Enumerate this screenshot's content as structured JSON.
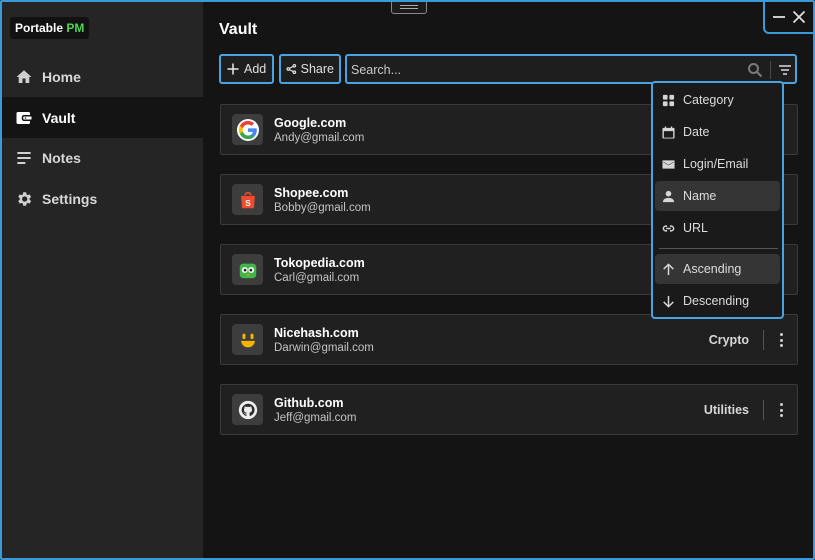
{
  "app": {
    "logo_text": "Portable ",
    "logo_accent": "PM"
  },
  "sidebar": {
    "items": [
      {
        "label": "Home",
        "icon": "home-icon",
        "active": false
      },
      {
        "label": "Vault",
        "icon": "wallet-icon",
        "active": true
      },
      {
        "label": "Notes",
        "icon": "notes-icon",
        "active": false
      },
      {
        "label": "Settings",
        "icon": "gear-icon",
        "active": false
      }
    ]
  },
  "window_controls": {
    "minimize": "minimize-icon",
    "close": "close-icon"
  },
  "main": {
    "title": "Vault",
    "toolbar": {
      "add_label": "Add",
      "share_label": "Share",
      "search_placeholder": "Search..."
    },
    "entries": [
      {
        "name": "Google.com",
        "email": "Andy@gmail.com",
        "category": "",
        "icon": "google-logo-icon"
      },
      {
        "name": "Shopee.com",
        "email": "Bobby@gmail.com",
        "category": "",
        "icon": "shopee-logo-icon"
      },
      {
        "name": "Tokopedia.com",
        "email": "Carl@gmail.com",
        "category": "",
        "icon": "tokopedia-logo-icon"
      },
      {
        "name": "Nicehash.com",
        "email": "Darwin@gmail.com",
        "category": "Crypto",
        "icon": "nicehash-logo-icon"
      },
      {
        "name": "Github.com",
        "email": "Jeff@gmail.com",
        "category": "Utilities",
        "icon": "github-logo-icon"
      }
    ]
  },
  "sort_menu": {
    "items": [
      {
        "label": "Category",
        "icon": "grid-icon",
        "highlighted": false
      },
      {
        "label": "Date",
        "icon": "calendar-icon",
        "highlighted": false
      },
      {
        "label": "Login/Email",
        "icon": "mail-icon",
        "highlighted": false
      },
      {
        "label": "Name",
        "icon": "person-icon",
        "highlighted": true
      },
      {
        "label": "URL",
        "icon": "link-icon",
        "highlighted": false
      }
    ],
    "order": [
      {
        "label": "Ascending",
        "icon": "arrow-up-icon",
        "highlighted": true
      },
      {
        "label": "Descending",
        "icon": "arrow-down-icon",
        "highlighted": false
      }
    ]
  },
  "colors": {
    "accent_border": "#4aa3df",
    "logo_accent": "#4fd44f",
    "sidebar_bg": "#252525",
    "main_bg": "#141414"
  }
}
